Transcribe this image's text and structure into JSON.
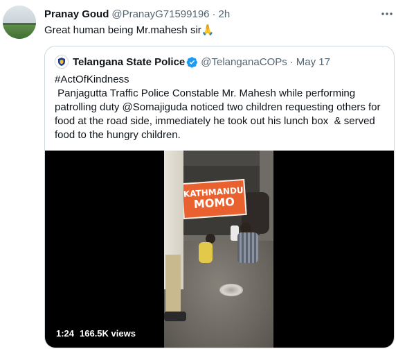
{
  "tweet": {
    "author_name": "Pranay Goud",
    "author_handle": "@PranayG71599196",
    "separator": "·",
    "time": "2h",
    "text": "Great human being Mr.mahesh sir🙏",
    "more_icon": "more-horizontal-icon"
  },
  "quoted_tweet": {
    "author_name": "Telangana State Police",
    "verified_icon": "verified-badge-icon",
    "author_handle": "@TelanganaCOPs",
    "separator": "·",
    "date": "May 17",
    "lines": [
      "#ActOfKindness",
      " Panjagutta Traffic Police Constable Mr. Mahesh while performing",
      "patrolling duty @Somajiguda noticed two children requesting others for",
      "food at the road side, immediately he took out his lunch box  & served",
      "food to the hungry children."
    ],
    "video": {
      "duration": "1:24",
      "views": "166.5K views",
      "sign_line1": "KATHMANDU",
      "sign_line2": "MOMO"
    }
  },
  "colors": {
    "text_primary": "#0f1419",
    "text_secondary": "#536471",
    "border": "#cfd9de",
    "verified_blue": "#1d9bf0"
  }
}
